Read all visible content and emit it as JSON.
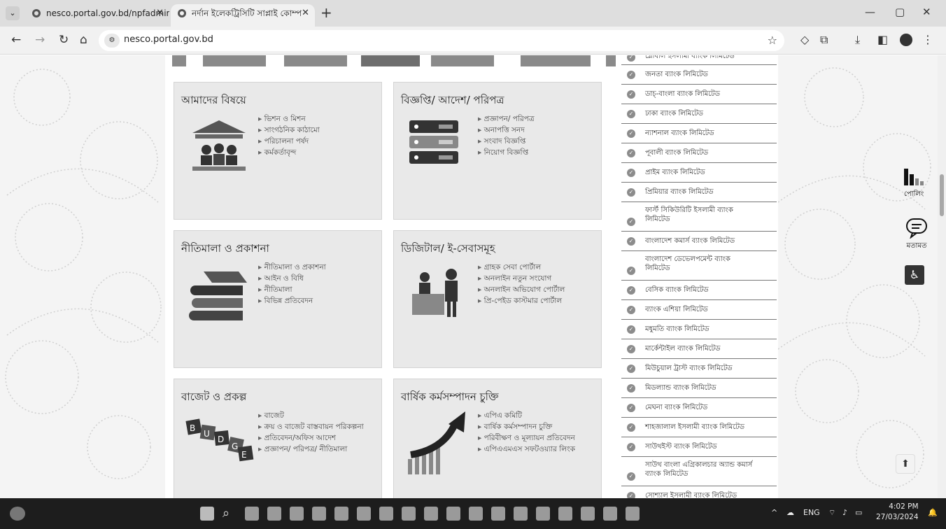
{
  "browser": {
    "tabs": [
      {
        "title": "nesco.portal.gov.bd/npfadmin/",
        "active": false
      },
      {
        "title": "নর্দান ইলেকট্রিসিটি সাপ্লাই কোম্প",
        "active": true
      }
    ],
    "url": "nesco.portal.gov.bd"
  },
  "boxes": [
    {
      "title": "আমাদের বিষয়ে",
      "items": [
        "ভিশন ও মিশন",
        "সাংগঠনিক কাঠামো",
        "পরিচালনা পর্ষদ",
        "কর্মকর্তাবৃন্দ"
      ],
      "icon": "government-building-icon"
    },
    {
      "title": "বিজ্ঞপ্তি/ আদেশ/ পরিপত্র",
      "items": [
        "প্রজ্ঞাপন/ পরিপত্র",
        "অনাপত্তি সনদ",
        "সংবাদ বিজ্ঞপ্তি",
        "নিয়োগ বিজ্ঞপ্তি"
      ],
      "icon": "server-rack-icon"
    },
    {
      "title": "নীতিমালা ও প্রকাশনা",
      "items": [
        "নীতিমালা ও প্রকাশনা",
        "আইন ও বিধি",
        "নীতিমালা",
        "বিভিন্ন প্রতিবেদন"
      ],
      "icon": "books-icon"
    },
    {
      "title": "ডিজিটাল/ ই-সেবাসমূহ",
      "items": [
        "গ্রাহক সেবা পোর্টাল",
        "অনলাইন নতুন সংযোগ",
        "অনলাইন অভিযোগ পোর্টাল",
        "প্রি-পেইড কাস্টমার পোর্টাল"
      ],
      "icon": "service-desk-icon"
    },
    {
      "title": "বাজেট ও প্রকল্প",
      "items": [
        "বাজেট",
        "ক্রয় ও বাজেট বাস্তবায়ন পরিকল্পনা",
        "প্রতিবেদন/অফিস আদেশ",
        "প্রজ্ঞাপন/ পরিপত্র/ নীতিমালা"
      ],
      "icon": "budget-cubes-icon"
    },
    {
      "title": "বার্ষিক কর্মসম্পাদন চুক্তি",
      "items": [
        "এপিএ কমিটি",
        "বার্ষিক কর্মসম্পাদন চুক্তি",
        "পরিবীক্ষণ ও মূল্যায়ন প্রতিবেদন",
        "এপিএএমএস সফটওয়্যার লিংক"
      ],
      "icon": "growth-arrow-icon"
    }
  ],
  "banks": [
    "গ্লোবাল ইসলামী ব্যাংক লিমিটেড",
    "জনতা ব্যাংক লিমিটেড",
    "ডাচ্-বাংলা ব্যাংক লিমিটেড",
    "ঢাকা ব্যাংক লিমিটেড",
    "ন্যাশনাল ব্যাংক লিমিটেড",
    "পূবালী ব্যাংক লিমিটেড",
    "প্রাইম ব্যাংক লিমিটেড",
    "প্রিমিয়ার ব্যাংক লিমিটেড",
    "ফার্স্ট সিকিউরিটি ইসলামী ব্যাংক লিমিটেড",
    "বাংলাদেশ কমার্স ব্যাংক লিমিটেড",
    "বাংলাদেশ ডেভেলপমেন্ট ব্যাংক লিমিটেড",
    "বেসিক ব্যাংক লিমিটেড",
    "ব্যাংক এশিয়া লিমিটেড",
    "মধুমতি ব্যাংক লিমিটেড",
    "মার্কেন্টাইল ব্যাংক লিমিটেড",
    "মিউচুয়াল ট্রাস্ট ব্যাংক লিমিটেড",
    "মিডল্যান্ড ব্যাংক লিমিটেড",
    "মেঘনা ব্যাংক লিমিটেড",
    "শাহজালাল ইসলামী ব্যাংক লিমিটেড",
    "সাউথইস্ট ব্যাংক লিমিটেড",
    "সাউথ বাংলা এগ্রিকালচার অ্যান্ড কমার্স ব্যাংক লিমিটেড",
    "সোশ্যাল ইসলামী ব্যাংক লিমিটেড"
  ],
  "side": {
    "poll_label": "পোলিং",
    "feedback_label": "মতামত"
  },
  "taskbar": {
    "lang": "ENG",
    "time": "4:02 PM",
    "date": "27/03/2024"
  }
}
